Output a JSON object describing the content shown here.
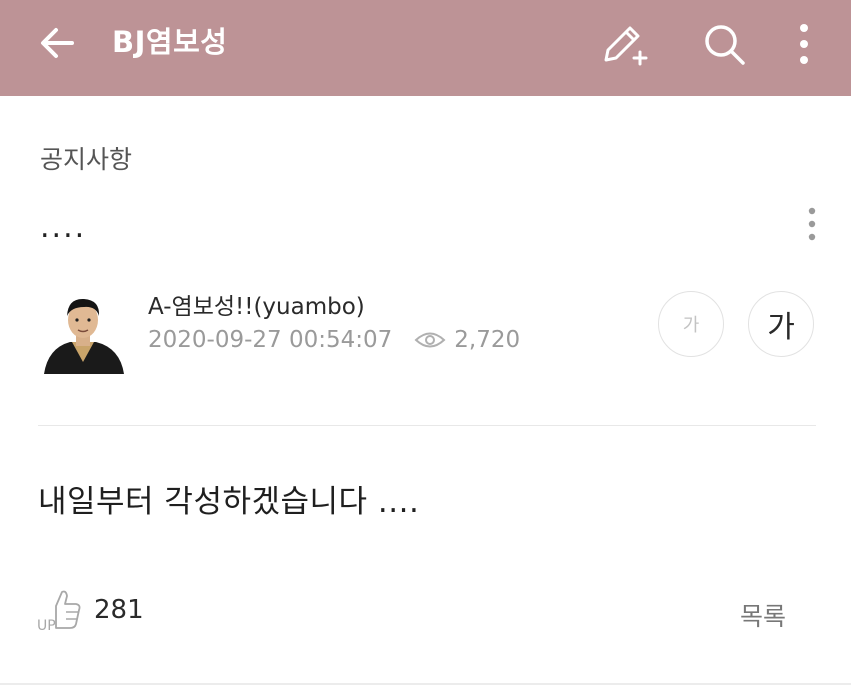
{
  "header": {
    "title": "BJ염보성",
    "background": "#bd9396",
    "icons": [
      "back-arrow-icon",
      "pencil-plus-icon",
      "search-icon",
      "more-vertical-icon"
    ]
  },
  "board": {
    "name": "공지사항"
  },
  "post": {
    "title": "....",
    "author": "A-염보성!!(yuambo)",
    "date": "2020-09-27 00:54:07",
    "views": "2,720",
    "font_small_label": "가",
    "font_large_label": "가",
    "body": "내일부터 각성하겠습니다 ....",
    "likes": "281",
    "list_label": "목록"
  }
}
